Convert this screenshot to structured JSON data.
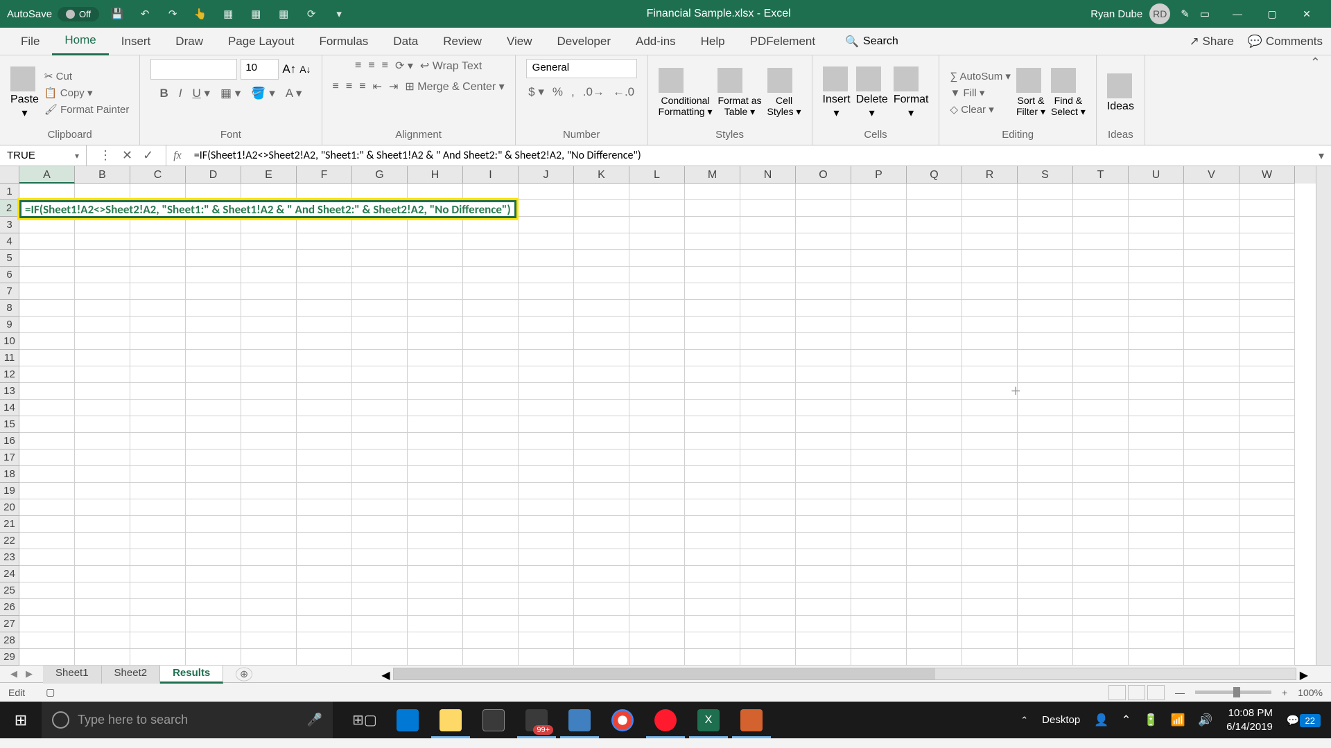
{
  "titleBar": {
    "autoSave": "AutoSave",
    "autoSaveState": "Off",
    "documentTitle": "Financial Sample.xlsx - Excel",
    "userName": "Ryan Dube",
    "userInitials": "RD"
  },
  "ribbonTabs": [
    "File",
    "Home",
    "Insert",
    "Draw",
    "Page Layout",
    "Formulas",
    "Data",
    "Review",
    "View",
    "Developer",
    "Add-ins",
    "Help",
    "PDFelement"
  ],
  "ribbonTabsActive": "Home",
  "searchPlaceholder": "Search",
  "shareLabel": "Share",
  "commentsLabel": "Comments",
  "clipboard": {
    "paste": "Paste",
    "cut": "Cut",
    "copy": "Copy",
    "formatPainter": "Format Painter",
    "groupLabel": "Clipboard"
  },
  "font": {
    "size": "10",
    "groupLabel": "Font"
  },
  "alignment": {
    "wrapText": "Wrap Text",
    "mergeCenter": "Merge & Center",
    "groupLabel": "Alignment"
  },
  "number": {
    "format": "General",
    "groupLabel": "Number"
  },
  "styles": {
    "conditional": "Conditional Formatting",
    "formatTable": "Format as Table",
    "cellStyles": "Cell Styles",
    "groupLabel": "Styles"
  },
  "cells": {
    "insert": "Insert",
    "delete": "Delete",
    "format": "Format",
    "groupLabel": "Cells"
  },
  "editing": {
    "autoSum": "AutoSum",
    "fill": "Fill",
    "clear": "Clear",
    "sortFilter": "Sort & Filter",
    "findSelect": "Find & Select",
    "groupLabel": "Editing"
  },
  "ideas": {
    "ideas": "Ideas",
    "groupLabel": "Ideas"
  },
  "formulaBar": {
    "nameBox": "TRUE",
    "formula": "=IF(Sheet1!A2<>Sheet2!A2, \"Sheet1:\" & Sheet1!A2 & \" And Sheet2:\" & Sheet2!A2, \"No Difference\")"
  },
  "columns": [
    "A",
    "B",
    "C",
    "D",
    "E",
    "F",
    "G",
    "H",
    "I",
    "J",
    "K",
    "L",
    "M",
    "N",
    "O",
    "P",
    "Q",
    "R",
    "S",
    "T",
    "U",
    "V",
    "W"
  ],
  "rows": [
    "1",
    "2",
    "3",
    "4",
    "5",
    "6",
    "7",
    "8",
    "9",
    "10",
    "11",
    "12",
    "13",
    "14",
    "15",
    "16",
    "17",
    "18",
    "19",
    "20",
    "21",
    "22",
    "23",
    "24",
    "25",
    "26",
    "27",
    "28",
    "29"
  ],
  "activeCellFormula": "=IF(Sheet1!A2<>Sheet2!A2, \"Sheet1:\" & Sheet1!A2 & \" And Sheet2:\" & Sheet2!A2, \"No Difference\")",
  "sheetTabs": [
    "Sheet1",
    "Sheet2",
    "Results"
  ],
  "activeSheet": "Results",
  "statusBar": {
    "mode": "Edit",
    "zoom": "100%"
  },
  "taskbar": {
    "searchPlaceholder": "Type here to search",
    "desktop": "Desktop",
    "time": "10:08 PM",
    "date": "6/14/2019",
    "notifications": "22",
    "mailBadge": "99+"
  }
}
